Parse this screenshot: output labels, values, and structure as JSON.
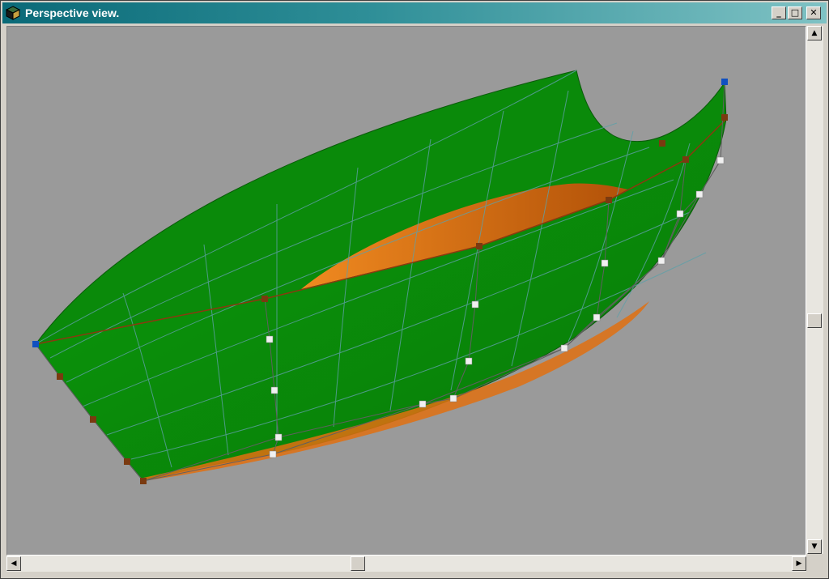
{
  "window": {
    "title": "Perspective view.",
    "controls": {
      "minimize": "_",
      "maximize": "□",
      "close": "✕"
    }
  },
  "icons": {
    "app": "cube-icon",
    "scroll_up": "arrow-up-icon",
    "scroll_down": "arrow-down-icon",
    "scroll_left": "arrow-left-icon",
    "scroll_right": "arrow-right-icon"
  },
  "colors": {
    "viewport_background": "#9a9a9a",
    "hull_outer": "#0a8c0a",
    "hull_inner": "#f07a10",
    "wireframe": "#5fa0a8",
    "control_point": "#f0f0f0",
    "edge_point": "#7a3a10",
    "corner_point": "#1050c0",
    "control_polygon": "#606060"
  },
  "scrollbars": {
    "vertical_position": 0.55,
    "horizontal_position": 0.44
  }
}
